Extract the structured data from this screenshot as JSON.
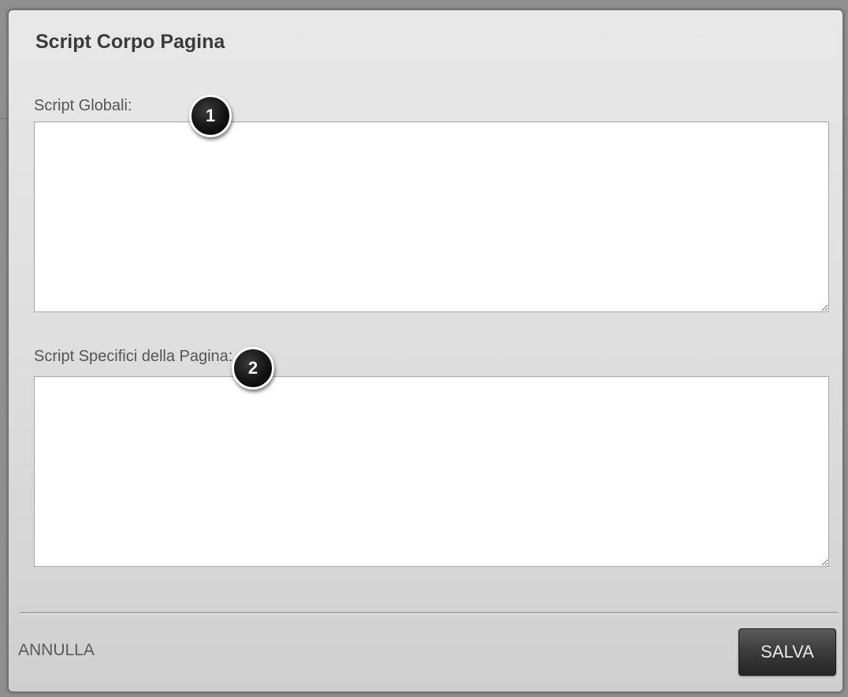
{
  "dialog": {
    "title": "Script Corpo Pagina",
    "fields": [
      {
        "label": "Script Globali:",
        "value": ""
      },
      {
        "label": "Script Specifici della Pagina:",
        "value": ""
      }
    ],
    "callouts": [
      "1",
      "2"
    ],
    "footer": {
      "cancel_label": "ANNULLA",
      "save_label": "SALVA"
    }
  },
  "colors": {
    "dialog_bg": "#e0e0e0",
    "save_button": "#333333",
    "callout": "#111111"
  }
}
